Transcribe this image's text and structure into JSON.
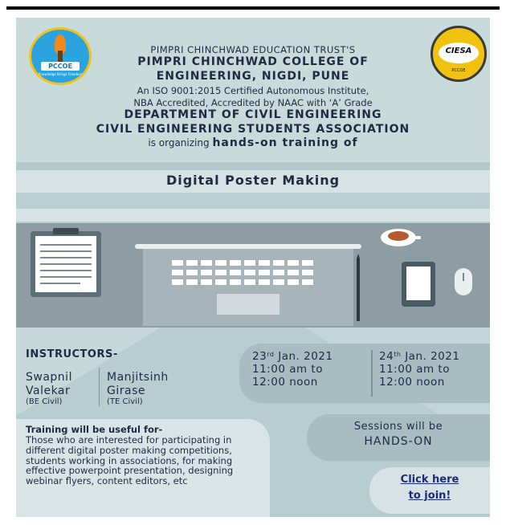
{
  "header": {
    "trust": "PIMPRI CHINCHWAD EDUCATION TRUST'S",
    "college_line1": "PIMPRI CHINCHWAD COLLEGE OF",
    "college_line2": "ENGINEERING, NIGDI, PUNE",
    "iso": "An ISO 9001:2015 Certified Autonomous Institute,",
    "accreditation": "NBA Accredited, Accredited by NAAC with ‘A’ Grade",
    "department": "DEPARTMENT OF CIVIL ENGINEERING",
    "association": "CIVIL ENGINEERING STUDENTS ASSOCIATION",
    "organizing_prefix": "is organizing",
    "organizing_bold": "hands-on training of"
  },
  "logos": {
    "left_label": "PCCOE",
    "left_tagline": "Knowledge Brings Freedom",
    "right_label": "CIESA",
    "right_bottom": "PCCOE"
  },
  "title": "Digital Poster Making",
  "instructors": {
    "heading": "INSTRUCTORS-",
    "people": [
      {
        "first": "Swapnil",
        "last": "Valekar",
        "role": "(BE Civil)"
      },
      {
        "first": "Manjitsinh",
        "last": "Girase",
        "role": "(TE Civil)"
      }
    ]
  },
  "sessions_dates": [
    {
      "day": "23",
      "suffix": "rd",
      "month_year": "Jan. 2021",
      "start": "11:00 am to",
      "end": "12:00 noon"
    },
    {
      "day": "24",
      "suffix": "th",
      "month_year": "Jan. 2021",
      "start": "11:00 am to",
      "end": "12:00 noon"
    }
  ],
  "training": {
    "heading": "Training will be useful for-",
    "body": "Those who are interested for participating in different digital poster making competitions, students working in associations, for making effective powerpoint presentation, designing webinar flyers, content editors, etc"
  },
  "sessions_note": {
    "line1": "Sessions will be",
    "line2": "HANDS-ON"
  },
  "join": {
    "line1": "Click here",
    "line2": "to join!"
  },
  "colors": {
    "text_dark": "#1f2a44",
    "link": "#1a2b7a",
    "bg_light": "#c9dadb",
    "bg_mid": "#b9cfd1",
    "illustration_bg": "#8e9da3"
  }
}
